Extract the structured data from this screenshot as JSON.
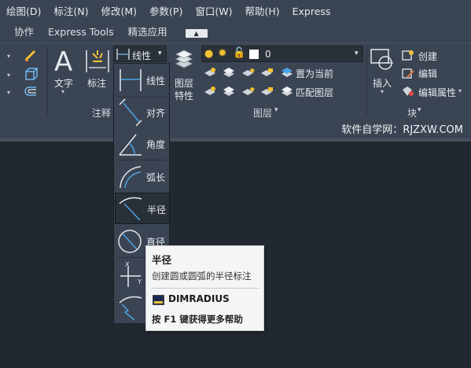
{
  "menu": [
    "绘图(D)",
    "标注(N)",
    "修改(M)",
    "参数(P)",
    "窗口(W)",
    "帮助(H)",
    "Express"
  ],
  "tabs": [
    "协作",
    "Express Tools",
    "精选应用"
  ],
  "ribbon": {
    "annotation": {
      "text_label": "文字",
      "dim_label": "标注",
      "dim_dropdown_value": "线性",
      "panel_title": "注释"
    },
    "layers": {
      "big_button_line1": "图层",
      "big_button_line2": "特性",
      "layer_value": "0",
      "set_current": "置为当前",
      "match_layer": "匹配图层",
      "panel_title": "图层"
    },
    "block": {
      "insert": "插入",
      "create": "创建",
      "edit": "编辑",
      "edit_attributes": "编辑属性",
      "panel_title": "块"
    }
  },
  "watermark": "软件自学网：RJZXW.COM",
  "flyout": {
    "items": [
      "线性",
      "对齐",
      "角度",
      "弧长",
      "半径",
      "直径"
    ],
    "active": "半径"
  },
  "tooltip": {
    "title": "半径",
    "description": "创建圆或圆弧的半径标注",
    "command": "DIMRADIUS",
    "help": "按 F1 键获得更多帮助"
  },
  "colors": {
    "ribbon_bg": "#3b4453",
    "canvas_bg": "#212830",
    "accent_blue": "#4aa3e6",
    "bulb_yellow": "#f2c230"
  }
}
